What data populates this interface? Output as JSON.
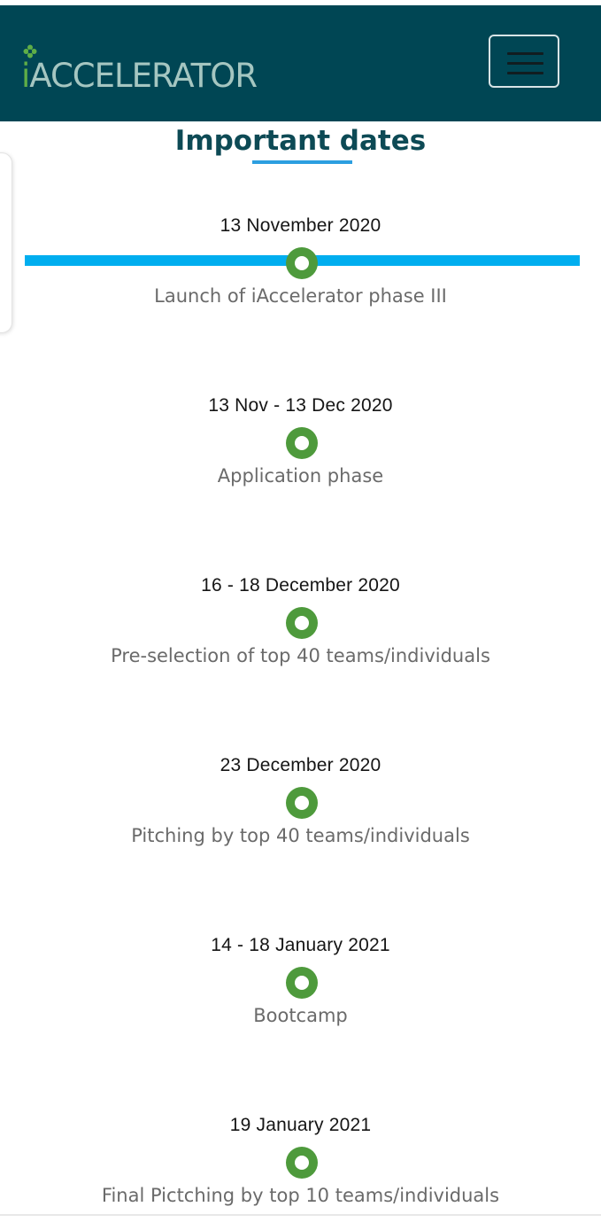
{
  "navbar": {
    "logo_i": "i",
    "logo_rest": "ACCELERATOR",
    "colors": {
      "background": "#004654",
      "logo_green": "#5fae47",
      "logo_text": "#a5c6c1"
    },
    "menu_icon": "hamburger-icon"
  },
  "section": {
    "title": "Important dates",
    "colors": {
      "title": "#0d4a55",
      "underline": "#2c9fe0",
      "timeline": "#00aeef",
      "dot": "#4e9a3c"
    }
  },
  "events": [
    {
      "date": "13 November 2020",
      "description": "Launch of iAccelerator phase III"
    },
    {
      "date": "13 Nov - 13 Dec 2020",
      "description": "Application phase"
    },
    {
      "date": "16 - 18 December 2020",
      "description": "Pre-selection of top 40 teams/individuals"
    },
    {
      "date": "23 December 2020",
      "description": "Pitching by top 40 teams/individuals"
    },
    {
      "date": "14 - 18 January 2021",
      "description": "Bootcamp"
    },
    {
      "date": "19 January 2021",
      "description": "Final Pictching by top 10 teams/individuals"
    }
  ]
}
